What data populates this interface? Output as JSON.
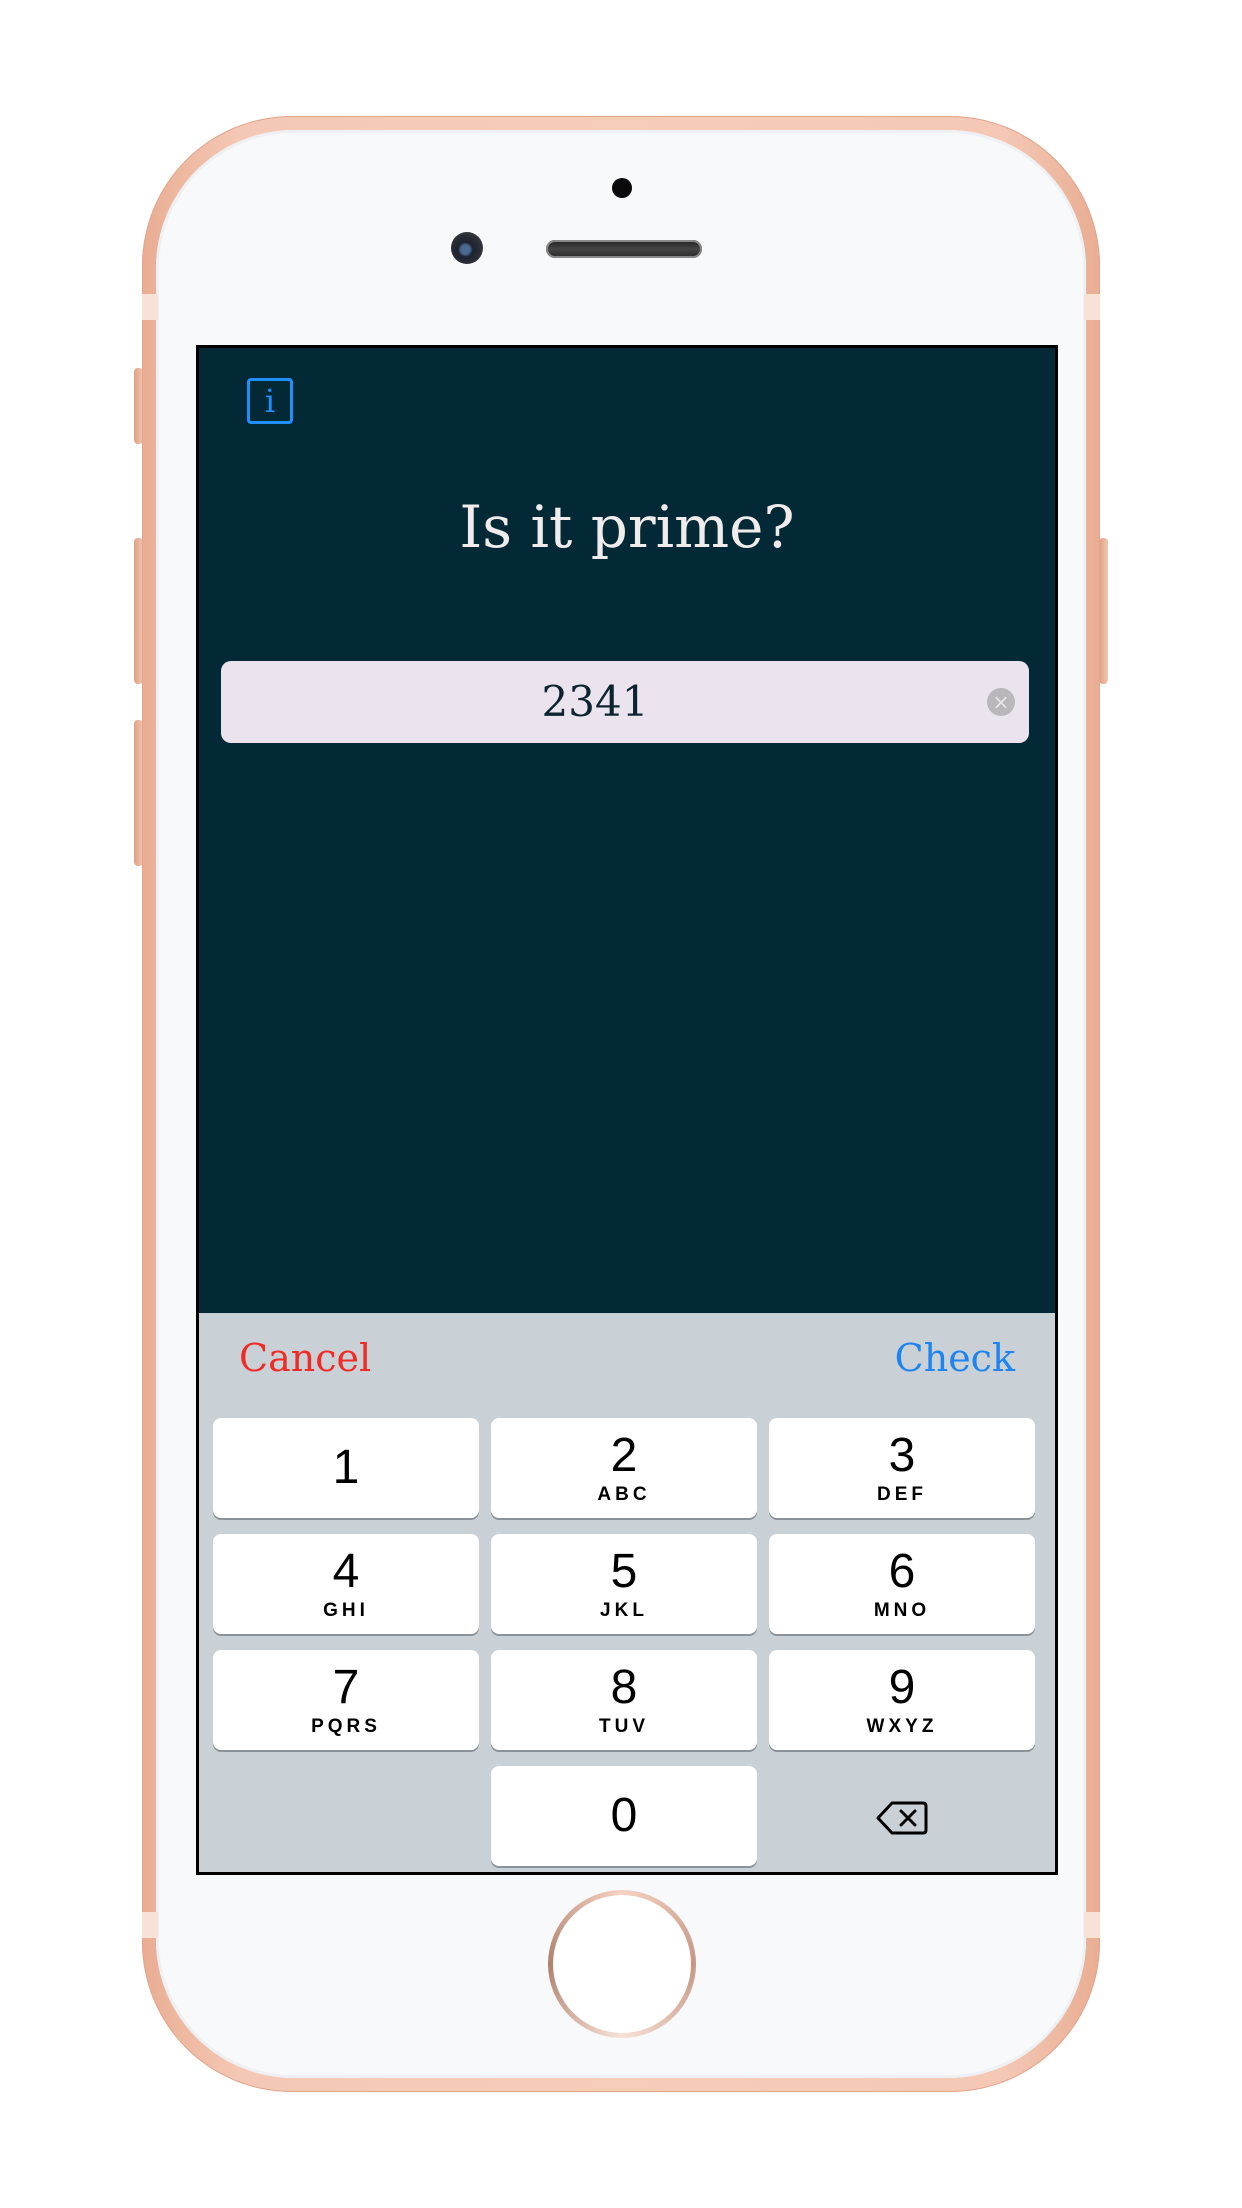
{
  "screen": {
    "info_icon": "i",
    "title": "Is it prime?",
    "number_value": "2341",
    "clear_icon": "×"
  },
  "accessory_bar": {
    "cancel_label": "Cancel",
    "check_label": "Check"
  },
  "keypad": {
    "keys": [
      {
        "digit": "1",
        "letters": ""
      },
      {
        "digit": "2",
        "letters": "ABC"
      },
      {
        "digit": "3",
        "letters": "DEF"
      },
      {
        "digit": "4",
        "letters": "GHI"
      },
      {
        "digit": "5",
        "letters": "JKL"
      },
      {
        "digit": "6",
        "letters": "MNO"
      },
      {
        "digit": "7",
        "letters": "PQRS"
      },
      {
        "digit": "8",
        "letters": "TUV"
      },
      {
        "digit": "9",
        "letters": "WXYZ"
      },
      {
        "digit": "0",
        "letters": ""
      }
    ],
    "delete_icon": "backspace-icon"
  },
  "colors": {
    "background": "#032936",
    "title": "#f1ecec",
    "field": "#ebe4ee",
    "cancel": "#f22a24",
    "check": "#1d84f1",
    "info": "#1f8ffb",
    "keyboard": "#c9d0d6",
    "frame": "#f4c8b4"
  }
}
